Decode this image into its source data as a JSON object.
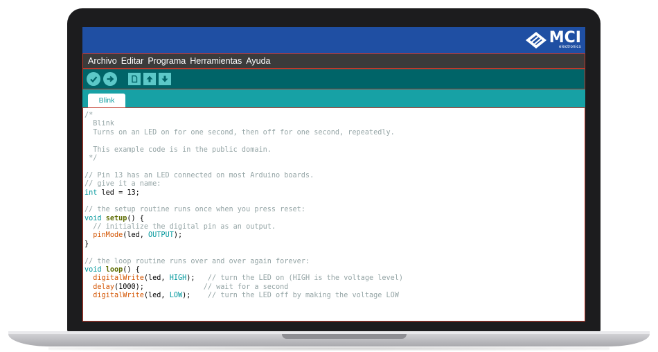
{
  "brand": {
    "name": "MCI",
    "subtitle": "electronics",
    "bar_color": "#1f4fa3"
  },
  "menu": {
    "items": [
      "Archivo",
      "Editar",
      "Programa",
      "Herramientas",
      "Ayuda"
    ]
  },
  "toolbar": {
    "buttons": [
      {
        "name": "verify-button",
        "icon": "checkmark-icon"
      },
      {
        "name": "upload-button",
        "icon": "arrow-right-icon"
      },
      {
        "name": "new-button",
        "icon": "new-file-icon"
      },
      {
        "name": "open-button",
        "icon": "open-up-arrow-icon"
      },
      {
        "name": "save-button",
        "icon": "save-down-arrow-icon"
      }
    ],
    "accent": "#5cc8c8",
    "bar_color": "#006468"
  },
  "tabs": {
    "active_label": "Blink",
    "strip_color": "#17a1a5"
  },
  "editor": {
    "lines": [
      [
        {
          "t": "/*",
          "c": "comment"
        }
      ],
      [
        {
          "t": "  Blink",
          "c": "comment"
        }
      ],
      [
        {
          "t": "  Turns on an LED on for one second, then off for one second, repeatedly.",
          "c": "comment"
        }
      ],
      [
        {
          "t": "",
          "c": "comment"
        }
      ],
      [
        {
          "t": "  This example code is in the public domain.",
          "c": "comment"
        }
      ],
      [
        {
          "t": " */",
          "c": "comment"
        }
      ],
      [
        {
          "t": "",
          "c": "comment"
        }
      ],
      [
        {
          "t": "// Pin 13 has an LED connected on most Arduino boards.",
          "c": "comment"
        }
      ],
      [
        {
          "t": "// give it a name:",
          "c": "comment"
        }
      ],
      [
        {
          "t": "int",
          "c": "type"
        },
        {
          "t": " led = 13;",
          "c": "plain"
        }
      ],
      [
        {
          "t": "",
          "c": "plain"
        }
      ],
      [
        {
          "t": "// the setup routine runs once when you press reset:",
          "c": "comment"
        }
      ],
      [
        {
          "t": "void",
          "c": "type"
        },
        {
          "t": " ",
          "c": "plain"
        },
        {
          "t": "setup",
          "c": "fn"
        },
        {
          "t": "() {",
          "c": "plain"
        }
      ],
      [
        {
          "t": "  // initialize the digital pin as an output.",
          "c": "comment"
        }
      ],
      [
        {
          "t": "  ",
          "c": "plain"
        },
        {
          "t": "pinMode",
          "c": "call"
        },
        {
          "t": "(led, ",
          "c": "plain"
        },
        {
          "t": "OUTPUT",
          "c": "const"
        },
        {
          "t": ");",
          "c": "plain"
        }
      ],
      [
        {
          "t": "}",
          "c": "plain"
        }
      ],
      [
        {
          "t": "",
          "c": "plain"
        }
      ],
      [
        {
          "t": "// the loop routine runs over and over again forever:",
          "c": "comment"
        }
      ],
      [
        {
          "t": "void",
          "c": "type"
        },
        {
          "t": " ",
          "c": "plain"
        },
        {
          "t": "loop",
          "c": "fn"
        },
        {
          "t": "() {",
          "c": "plain"
        }
      ],
      [
        {
          "t": "  ",
          "c": "plain"
        },
        {
          "t": "digitalWrite",
          "c": "call"
        },
        {
          "t": "(led, ",
          "c": "plain"
        },
        {
          "t": "HIGH",
          "c": "const"
        },
        {
          "t": ");   ",
          "c": "plain"
        },
        {
          "t": "// turn the LED on (HIGH is the voltage level)",
          "c": "comment"
        }
      ],
      [
        {
          "t": "  ",
          "c": "plain"
        },
        {
          "t": "delay",
          "c": "call"
        },
        {
          "t": "(1000);              ",
          "c": "plain"
        },
        {
          "t": "// wait for a second",
          "c": "comment"
        }
      ],
      [
        {
          "t": "  ",
          "c": "plain"
        },
        {
          "t": "digitalWrite",
          "c": "call"
        },
        {
          "t": "(led, ",
          "c": "plain"
        },
        {
          "t": "LOW",
          "c": "const"
        },
        {
          "t": ");    ",
          "c": "plain"
        },
        {
          "t": "// turn the LED off by making the voltage LOW",
          "c": "comment"
        }
      ]
    ]
  }
}
